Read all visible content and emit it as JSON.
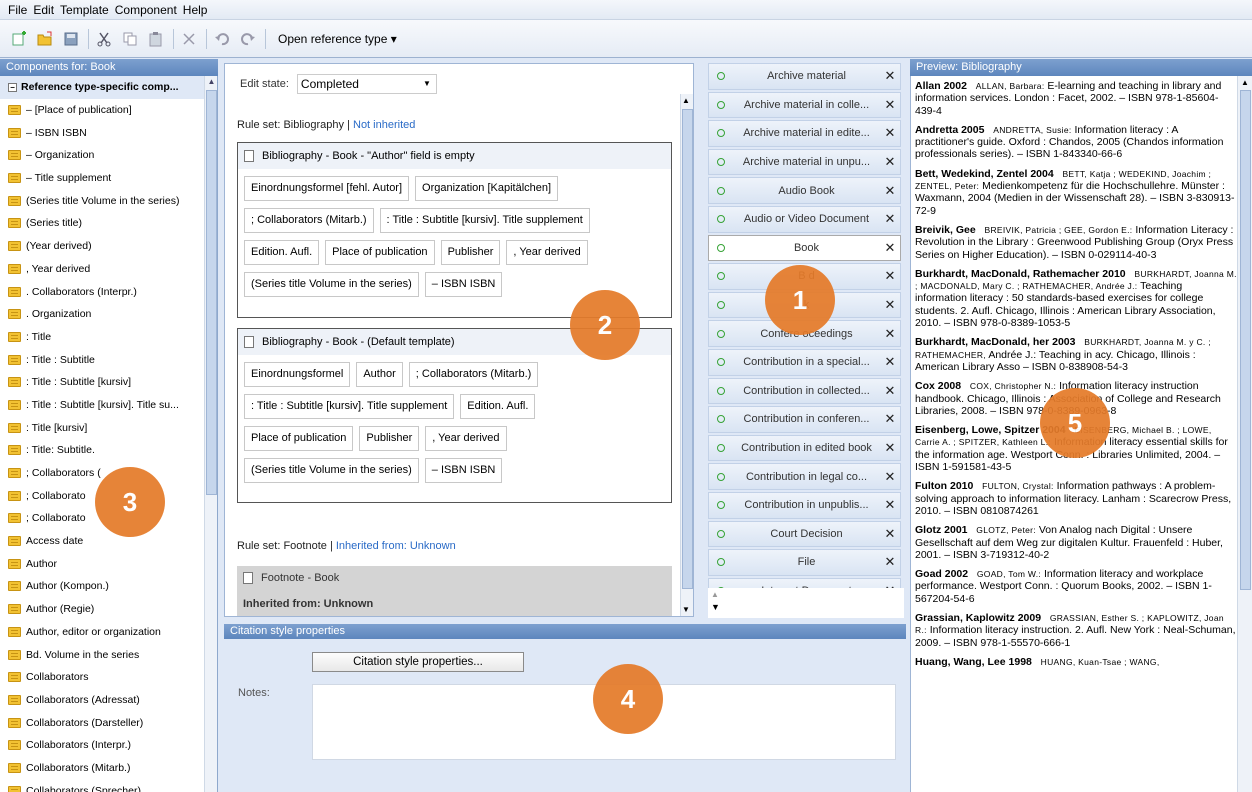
{
  "menu": [
    "File",
    "Edit",
    "Template",
    "Component",
    "Help"
  ],
  "toolbar": {
    "icons": [
      "new-icon",
      "open-icon",
      "save-icon",
      "cut-icon",
      "copy-icon",
      "paste-icon",
      "delete-icon",
      "undo-icon",
      "redo-icon"
    ],
    "open_reference_type": "Open reference type ▾"
  },
  "left": {
    "header": "Components for: Book",
    "root": "Reference type-specific comp...",
    "items": [
      "– [Place of publication]",
      "– ISBN ISBN",
      "– Organization",
      "– Title supplement",
      "(Series title Volume in the series)",
      "(Series title)",
      "(Year derived)",
      ", Year derived",
      ". Collaborators (Interpr.)",
      ". Organization",
      ": Title",
      ": Title : Subtitle",
      ": Title : Subtitle [kursiv]",
      ": Title : Subtitle [kursiv]. Title su...",
      ": Title [kursiv]",
      ": Title: Subtitle.",
      "; Collaborators (",
      "; Collaborato",
      "; Collaborato",
      "Access date",
      "Author",
      "Author (Kompon.)",
      "Author (Regie)",
      "Author, editor or organization",
      "Bd. Volume in the series",
      "Collaborators",
      "Collaborators (Adressat)",
      "Collaborators (Darsteller)",
      "Collaborators (Interpr.)",
      "Collaborators (Mitarb.)",
      "Collaborators (Sprecher)"
    ]
  },
  "editor": {
    "edit_state_label": "Edit state:",
    "edit_state_value": "Completed",
    "ruleset1_label": "Rule set: Bibliography",
    "ruleset1_link": "Not inherited",
    "template1": {
      "title": "Bibliography - Book - \"Author\" field is empty",
      "rows": [
        [
          "Einordnungsformel [fehl. Autor]",
          "Organization [Kapitälchen]"
        ],
        [
          "; Collaborators (Mitarb.)",
          ": Title : Subtitle [kursiv]. Title supplement"
        ],
        [
          "Edition. Aufl.",
          "Place of publication",
          "Publisher",
          ", Year derived"
        ],
        [
          "(Series title Volume in the series)",
          "– ISBN ISBN"
        ]
      ]
    },
    "template2": {
      "title": "Bibliography - Book - (Default template)",
      "rows": [
        [
          "Einordnungsformel",
          "Author",
          "; Collaborators (Mitarb.)"
        ],
        [
          ": Title : Subtitle [kursiv]. Title supplement",
          "Edition. Aufl."
        ],
        [
          "Place of publication",
          "Publisher",
          ", Year derived"
        ],
        [
          "(Series title Volume in the series)",
          "– ISBN ISBN"
        ]
      ]
    },
    "ruleset2_label": "Rule set: Footnote",
    "ruleset2_link": "Inherited from: Unknown",
    "footnote_title": "Footnote - Book",
    "footnote_inherited": "Inherited from: Unknown"
  },
  "types": [
    "Archive material",
    "Archive material in colle...",
    "Archive material in edite...",
    "Archive material in unpu...",
    "Audio Book",
    "Audio or Video Document",
    "Book",
    "B             d",
    "              k",
    "Confere    oceedings",
    "Contribution in a special...",
    "Contribution in collected...",
    "Contribution in conferen...",
    "Contribution in edited book",
    "Contribution in legal co...",
    "Contribution in unpublis...",
    "Court Decision",
    "File",
    "Internet Document"
  ],
  "active_type": "Book",
  "citation": {
    "header": "Citation style properties",
    "button": "Citation style properties...",
    "notes_label": "Notes:"
  },
  "preview": {
    "header": "Preview: Bibliography",
    "entries": [
      {
        "key": "Allan 2002",
        "auth": "ALLAN, Barbara:",
        "text": "E-learning and teaching in library and information services. London : Facet, 2002. – ISBN 978-1-85604-439-4"
      },
      {
        "key": "Andretta 2005",
        "auth": "ANDRETTA, Susie:",
        "text": "Information literacy : A practitioner's guide. Oxford : Chandos, 2005 (Chandos information professionals series). – ISBN 1-843340-66-6"
      },
      {
        "key": "Bett, Wedekind, Zentel 2004",
        "auth": "BETT, Katja ; WEDEKIND, Joachim ; ZENTEL, Peter:",
        "text": "Medienkompetenz für die Hochschullehre. Münster : Waxmann, 2004 (Medien in der Wissenschaft 28). – ISBN 3-830913-72-9"
      },
      {
        "key": "Breivik, Gee",
        "auth": "BREIVIK, Patricia ; GEE, Gordon E.:",
        "text": "Information Literacy : Revolution in the Library : Greenwood Publishing Group (Oryx Press Series on Higher Education). – ISBN 0-029114-40-3"
      },
      {
        "key": "Burkhardt, MacDonald, Rathemacher 2010",
        "auth": "BURKHARDT, Joanna M. ; MACDONALD, Mary C. ; RATHEMACHER, Andrée J.:",
        "text": "Teaching information literacy : 50 standards-based exercises for college students. 2. Aufl. Chicago, Illinois : American Library Association, 2010. – ISBN 978-0-8389-1053-5"
      },
      {
        "key": "Burkhardt, MacDonald,            her 2003",
        "auth": "BURKHARDT, Joanna M.           y C. ; RATHEMACHER,",
        "text": "Andrée J.: Teaching in          acy. Chicago, Illinois : American Library Asso          – ISBN 0-838908-54-3"
      },
      {
        "key": "Cox 2008",
        "auth": "COX, Christopher N.:",
        "text": "Information literacy instruction handbook. Chicago, Illinois : Association of College and Research Libraries, 2008. – ISBN 978-0-8389-0963-8"
      },
      {
        "key": "Eisenberg, Lowe, Spitzer 2004",
        "auth": "EISENBERG, Michael B. ; LOWE, Carrie A. ; SPITZER, Kathleen L.:",
        "text": "Information literacy essential skills for the information age. Westport Conn. : Libraries Unlimited, 2004. – ISBN 1-591581-43-5"
      },
      {
        "key": "Fulton 2010",
        "auth": "FULTON, Crystal:",
        "text": "Information pathways : A problem-solving approach to information literacy. Lanham : Scarecrow Press, 2010. – ISBN 0810874261"
      },
      {
        "key": "Glotz 2001",
        "auth": "GLOTZ, Peter:",
        "text": "Von Analog nach Digital : Unsere Gesellschaft auf dem Weg zur digitalen Kultur. Frauenfeld : Huber, 2001. – ISBN 3-719312-40-2"
      },
      {
        "key": "Goad 2002",
        "auth": "GOAD, Tom W.:",
        "text": "Information literacy and workplace performance. Westport Conn. : Quorum Books, 2002. – ISBN 1-567204-54-6"
      },
      {
        "key": "Grassian, Kaplowitz 2009",
        "auth": "GRASSIAN, Esther S. ; KAPLOWITZ, Joan R.:",
        "text": "Information literacy instruction. 2. Aufl. New York : Neal-Schuman, 2009. – ISBN 978-1-55570-666-1"
      },
      {
        "key": "Huang, Wang, Lee 1998",
        "auth": "HUANG, Kuan-Tsae ; WANG,",
        "text": ""
      }
    ]
  },
  "markers": [
    "1",
    "2",
    "3",
    "4",
    "5"
  ]
}
